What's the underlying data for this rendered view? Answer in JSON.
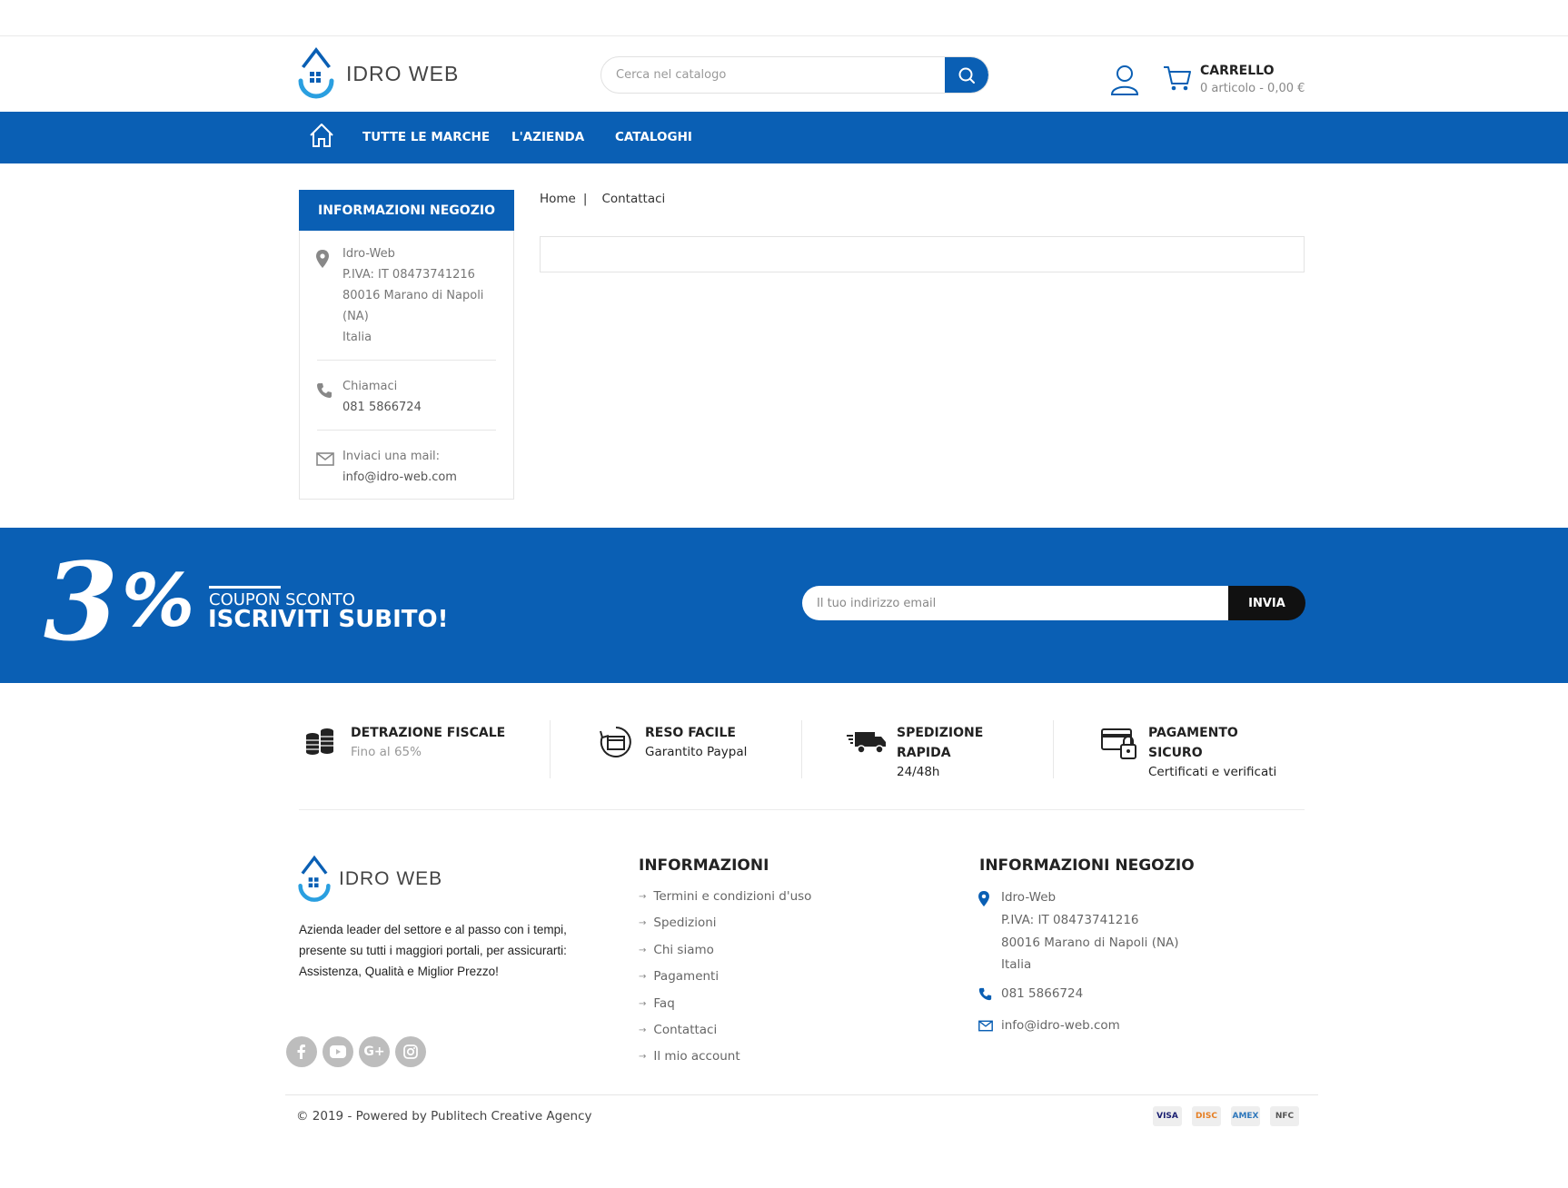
{
  "brand": {
    "name": "IDRO WEB",
    "accent": "#0a5fb4",
    "logo_drop": "#2a9fe0"
  },
  "search": {
    "placeholder": "Cerca nel catalogo",
    "icon": "search-icon"
  },
  "cart": {
    "title": "CARRELLO",
    "summary": "0 articolo - 0,00 €",
    "icon": "cart-icon"
  },
  "user": {
    "icon": "user-icon"
  },
  "nav": {
    "home_icon": "home-icon",
    "items": [
      "TUTTE LE MARCHE",
      "L'AZIENDA",
      "CATALOGHI"
    ]
  },
  "sidebar": {
    "heading": "INFORMAZIONI NEGOZIO",
    "address": [
      "Idro-Web",
      "P.IVA: IT 08473741216",
      "80016 Marano di Napoli",
      "(NA)",
      "Italia"
    ],
    "phone_label": "Chiamaci",
    "phone": "081 5866724",
    "mail_label": "Inviaci una mail:",
    "mail": "info@idro-web.com"
  },
  "breadcrumb": {
    "home": "Home",
    "separator": "|",
    "current": "Contattaci"
  },
  "promo": {
    "number": "3",
    "percent": "%",
    "coupon": "COUPON SCONTO",
    "cta": "ISCRIVITI SUBITO!",
    "email_placeholder": "Il tuo indirizzo email",
    "submit": "INVIA"
  },
  "features": [
    {
      "icon": "coins-icon",
      "title": [
        "DETRAZIONE FISCALE"
      ],
      "sub": "Fino al 65%"
    },
    {
      "icon": "return-box-icon",
      "title": [
        "RESO FACILE"
      ],
      "sub": "Garantito Paypal"
    },
    {
      "icon": "delivery-truck-icon",
      "title": [
        "SPEDIZIONE",
        "RAPIDA"
      ],
      "sub": "24/48h"
    },
    {
      "icon": "secure-card-icon",
      "title": [
        "PAGAMENTO",
        "SICURO"
      ],
      "sub": "Certificati e verificati"
    }
  ],
  "footer": {
    "brand": "IDRO WEB",
    "description": "Azienda leader del settore e al passo con i tempi, presente su tutti i maggiori portali, per assicurarti: Assistenza, Qualità e Miglior Prezzo!",
    "social": [
      "facebook-icon",
      "youtube-icon",
      "google-plus-icon",
      "instagram-icon"
    ],
    "info_heading": "INFORMAZIONI",
    "links": [
      "Termini e condizioni d'uso",
      "Spedizioni",
      "Chi siamo",
      "Pagamenti",
      "Faq",
      "Contattaci",
      "Il mio account"
    ],
    "shop_heading": "INFORMAZIONI NEGOZIO",
    "shop_address": [
      "Idro-Web",
      "P.IVA: IT 08473741216",
      "80016 Marano di Napoli (NA)",
      "Italia"
    ],
    "shop_phone": "081 5866724",
    "shop_mail": "info@idro-web.com",
    "copyright": "© 2019 - Powered by Publitech Creative Agency",
    "payments": [
      "VISA",
      "DISC",
      "AMEX",
      "NFC"
    ]
  }
}
